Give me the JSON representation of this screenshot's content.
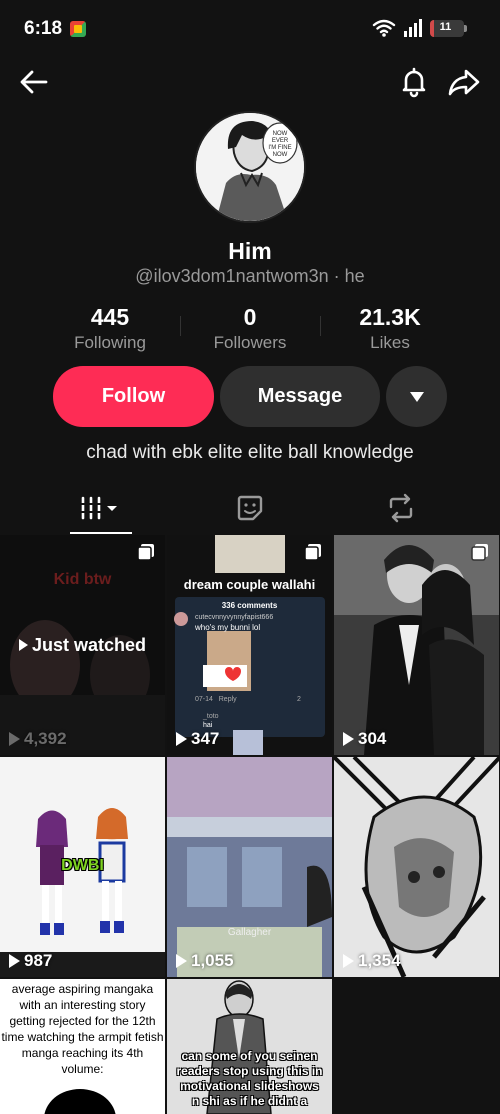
{
  "status_bar": {
    "time": "6:18",
    "battery": "11",
    "battery_level": 0.11
  },
  "profile": {
    "name": "Him",
    "handle": "@ilov3dom1nantwom3n · he",
    "avatar_text": "NOW EVER I'M FINE NOW (LOL)",
    "bio": "chad with ebk elite elite ball knowledge"
  },
  "stats": [
    {
      "value": "445",
      "label": "Following"
    },
    {
      "value": "0",
      "label": "Followers"
    },
    {
      "value": "21.3K",
      "label": "Likes"
    }
  ],
  "actions": {
    "follow": "Follow",
    "message": "Message"
  },
  "icons": {
    "back": "back-arrow-icon",
    "bell": "bell-icon",
    "share": "share-icon",
    "videos_tab": "grid-icon",
    "favorites_tab": "sticker-icon",
    "reposts_tab": "repost-icon"
  },
  "colors": {
    "accent": "#fe2c55",
    "background": "#121212",
    "button": "#2f2f2f"
  },
  "videos": [
    {
      "views": "4,392",
      "caption_top": "Kid btw",
      "caption": "Just watched",
      "multi": true,
      "dim": true
    },
    {
      "views": "347",
      "caption": "dream couple wallahi",
      "comments_header": "336 comments",
      "comment_user": "cutecvnnyvynnyfapist666",
      "comment_text": "who's my bunni lol",
      "comment_time": "07-14",
      "comment_reply": "Reply",
      "comment_likes": "2",
      "reply_user": "_toto",
      "reply_text": "hai",
      "multi": true
    },
    {
      "views": "304",
      "multi": true
    },
    {
      "views": "987",
      "caption": "DWBI"
    },
    {
      "views": "1,055",
      "caption": "Gallagher"
    },
    {
      "views": "1,354"
    },
    {
      "caption": "average aspiring mangaka with an interesting story getting rejected for the 12th time watching the armpit fetish manga reaching its 4th volume:"
    },
    {
      "caption": "can some of you seinen readers stop using this in motivational slideshows n shi as if he didnt a"
    }
  ]
}
